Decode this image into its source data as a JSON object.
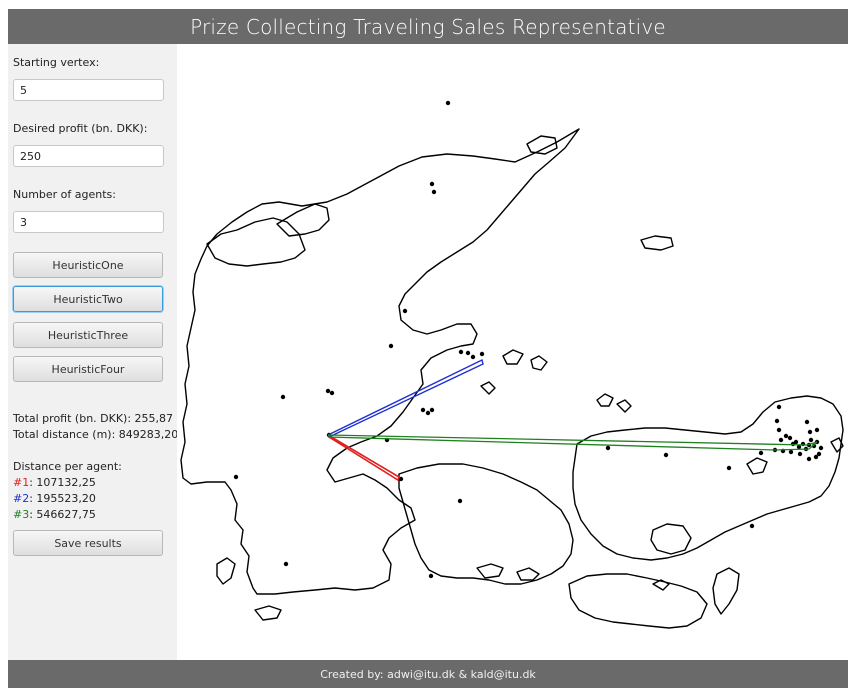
{
  "app": {
    "title": "Prize Collecting Traveling Sales Representative"
  },
  "form": {
    "start_label": "Starting vertex:",
    "start_value": "5",
    "profit_label": "Desired profit (bn. DKK):",
    "profit_value": "250",
    "agents_label": "Number of agents:",
    "agents_value": "3"
  },
  "buttons": {
    "h1": "HeuristicOne",
    "h2": "HeuristicTwo",
    "h3": "HeuristicThree",
    "h4": "HeuristicFour",
    "save": "Save results"
  },
  "results": {
    "total_profit": "Total profit (bn. DKK): 255,87",
    "total_distance": "Total distance (m): 849283,20",
    "per_agent_label": "Distance per agent:",
    "agents": [
      {
        "tag": "#1",
        "value": ": 107132,25",
        "color": "#e02020"
      },
      {
        "tag": "#2",
        "value": ": 195523,20",
        "color": "#2030d0"
      },
      {
        "tag": "#3",
        "value": ": 546627,75",
        "color": "#208020"
      }
    ]
  },
  "footer": {
    "text": "Created by: adwi@itu.dk & kald@itu.dk"
  }
}
